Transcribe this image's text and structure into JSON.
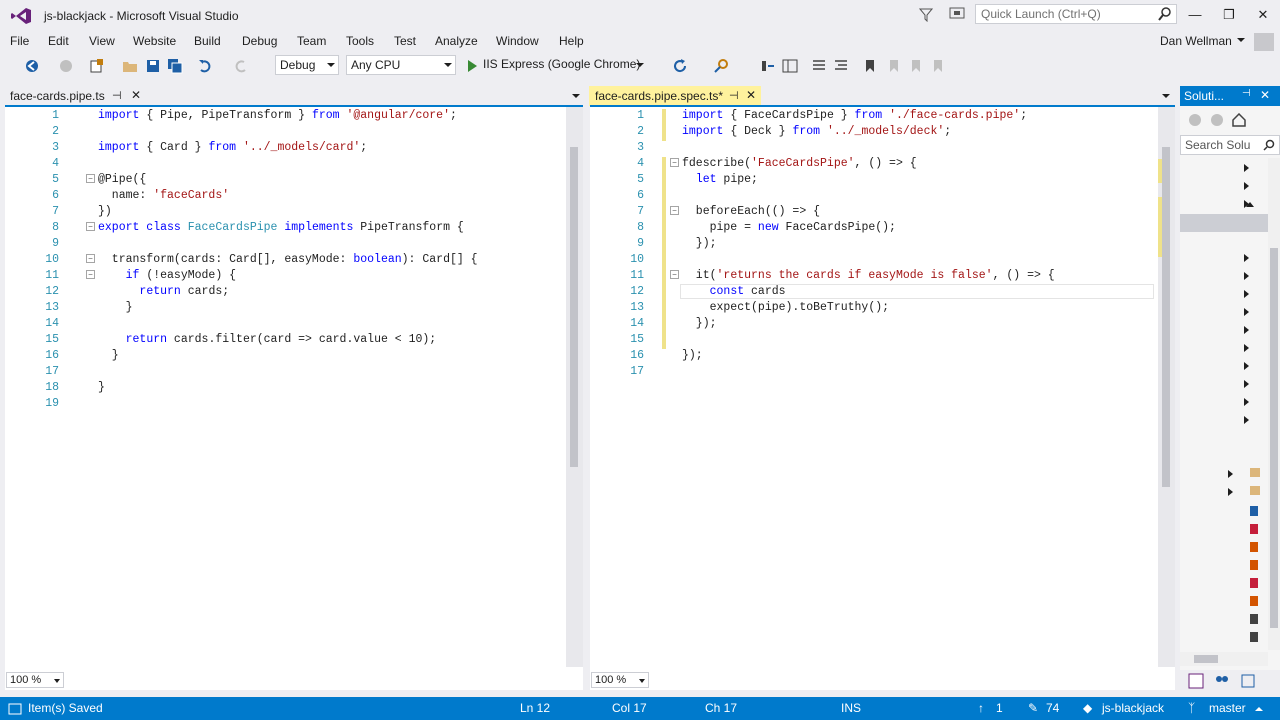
{
  "window": {
    "title": "js-blackjack - Microsoft Visual Studio",
    "quick_launch_placeholder": "Quick Launch (Ctrl+Q)",
    "user": "Dan Wellman"
  },
  "menu": [
    "File",
    "Edit",
    "View",
    "Website",
    "Build",
    "Debug",
    "Team",
    "Tools",
    "Test",
    "Analyze",
    "Window",
    "Help"
  ],
  "toolbar": {
    "config": "Debug",
    "platform": "Any CPU",
    "run_target": "IIS Express (Google Chrome)"
  },
  "left_editor": {
    "tab": "face-cards.pipe.ts",
    "zoom": "100 %",
    "line_numbers": [
      "1",
      "2",
      "3",
      "4",
      "5",
      "6",
      "7",
      "8",
      "9",
      "10",
      "11",
      "12",
      "13",
      "14",
      "15",
      "16",
      "17",
      "18",
      "19"
    ]
  },
  "right_editor": {
    "tab": "face-cards.pipe.spec.ts*",
    "zoom": "100 %",
    "line_numbers": [
      "1",
      "2",
      "3",
      "4",
      "5",
      "6",
      "7",
      "8",
      "9",
      "10",
      "11",
      "12",
      "13",
      "14",
      "15",
      "16",
      "17"
    ]
  },
  "solution_explorer": {
    "title": "Soluti...",
    "search_placeholder": "Search Solu"
  },
  "status": {
    "message": "Item(s) Saved",
    "ln": "Ln 12",
    "col": "Col 17",
    "ch": "Ch 17",
    "mode": "INS",
    "up_count": "1",
    "changes": "74",
    "repo": "js-blackjack",
    "branch": "master"
  },
  "colors": {
    "accent": "#007acc",
    "keyword": "#0000ff",
    "string": "#a31515",
    "type": "#2b91af",
    "active_tab": "#fff29d"
  }
}
